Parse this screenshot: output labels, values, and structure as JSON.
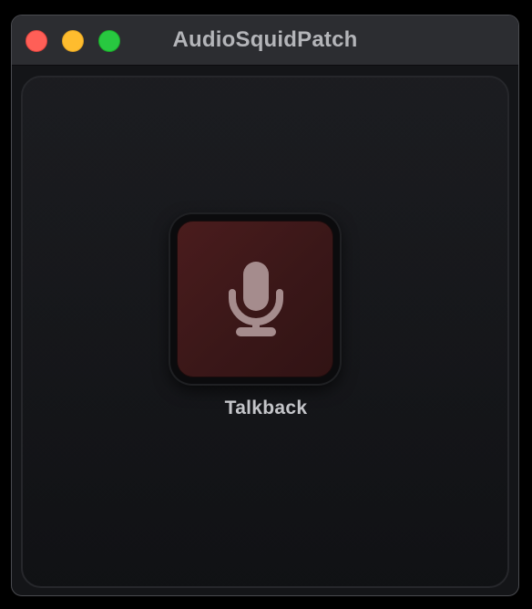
{
  "window": {
    "title": "AudioSquidPatch",
    "controls": {
      "close_color": "#ff5f57",
      "minimize_color": "#febc2e",
      "zoom_color": "#28c840"
    }
  },
  "main": {
    "talkback": {
      "label": "Talkback",
      "icon": "microphone-icon",
      "button_color": "#4a1c1d"
    }
  }
}
